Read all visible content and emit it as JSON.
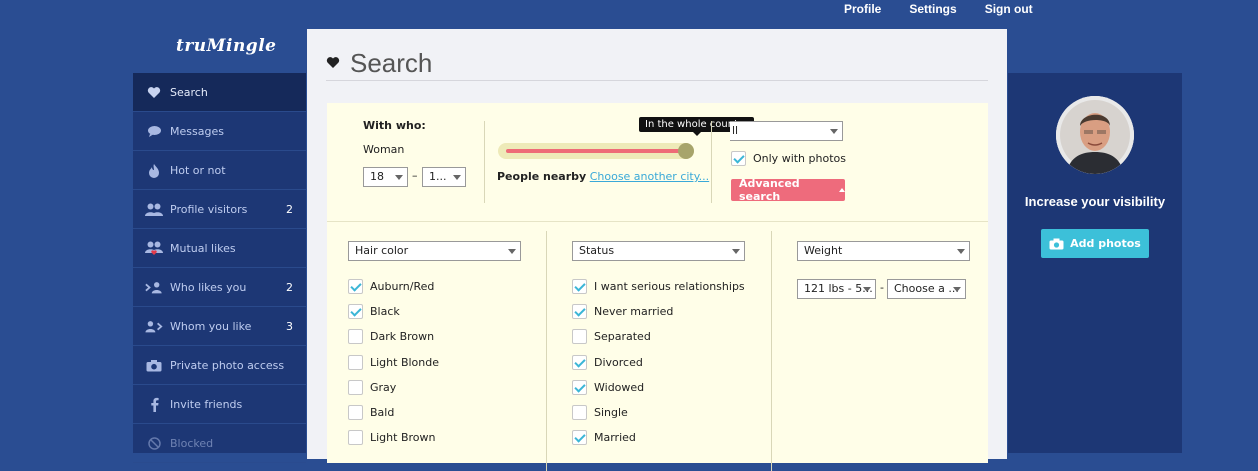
{
  "topnav": {
    "profile": "Profile",
    "settings": "Settings",
    "signout": "Sign out"
  },
  "logo": "truMingle",
  "sidebar": {
    "items": [
      {
        "label": "Search",
        "icon": "heart-icon",
        "count": ""
      },
      {
        "label": "Messages",
        "icon": "speech-bubble-icon",
        "count": ""
      },
      {
        "label": "Hot or not",
        "icon": "flame-icon",
        "count": ""
      },
      {
        "label": "Profile visitors",
        "icon": "people-icon",
        "count": "2"
      },
      {
        "label": "Mutual likes",
        "icon": "mutual-people-icon",
        "count": ""
      },
      {
        "label": "Who likes you",
        "icon": "incoming-person-icon",
        "count": "2"
      },
      {
        "label": "Whom you like",
        "icon": "outgoing-person-icon",
        "count": "3"
      },
      {
        "label": "Private photo access",
        "icon": "camera-icon",
        "count": ""
      },
      {
        "label": "Invite friends",
        "icon": "facebook-icon",
        "count": ""
      },
      {
        "label": "Blocked",
        "icon": "blocked-icon",
        "count": ""
      }
    ]
  },
  "page": {
    "title": "Search"
  },
  "search": {
    "with_who_label": "With who:",
    "with_who_value": "Woman",
    "age_min": "18",
    "age_dash": "–",
    "age_max": "1...",
    "slider_tooltip": "In the whole country",
    "slider_level": 1.0,
    "people_nearby": "People nearby",
    "choose_city": "Choose another city...",
    "all_select": "ll",
    "only_photos": "Only with photos",
    "only_photos_checked": true,
    "advanced": "Advanced search"
  },
  "filters": {
    "hair": {
      "select": "Hair color",
      "options": [
        {
          "label": "Auburn/Red",
          "checked": true
        },
        {
          "label": "Black",
          "checked": true
        },
        {
          "label": "Dark Brown",
          "checked": false
        },
        {
          "label": "Light Blonde",
          "checked": false
        },
        {
          "label": "Gray",
          "checked": false
        },
        {
          "label": "Bald",
          "checked": false
        },
        {
          "label": "Light Brown",
          "checked": false
        }
      ]
    },
    "status": {
      "select": "Status",
      "options": [
        {
          "label": "I want serious relationships",
          "checked": true
        },
        {
          "label": "Never married",
          "checked": true
        },
        {
          "label": "Separated",
          "checked": false
        },
        {
          "label": "Divorced",
          "checked": true
        },
        {
          "label": "Widowed",
          "checked": true
        },
        {
          "label": "Single",
          "checked": false
        },
        {
          "label": "Married",
          "checked": true
        }
      ]
    },
    "weight": {
      "select": "Weight",
      "min": "121 lbs - 5...",
      "dash": "-",
      "max": "Choose a ..."
    }
  },
  "right": {
    "visibility": "Increase your visibility",
    "add_photos": "Add photos"
  },
  "colors": {
    "bg": "#2a4d92",
    "sidebar": "#1d3775",
    "accent": "#ee6b7c",
    "check": "#3bb6d6",
    "add_photos": "#3cc0d9"
  }
}
